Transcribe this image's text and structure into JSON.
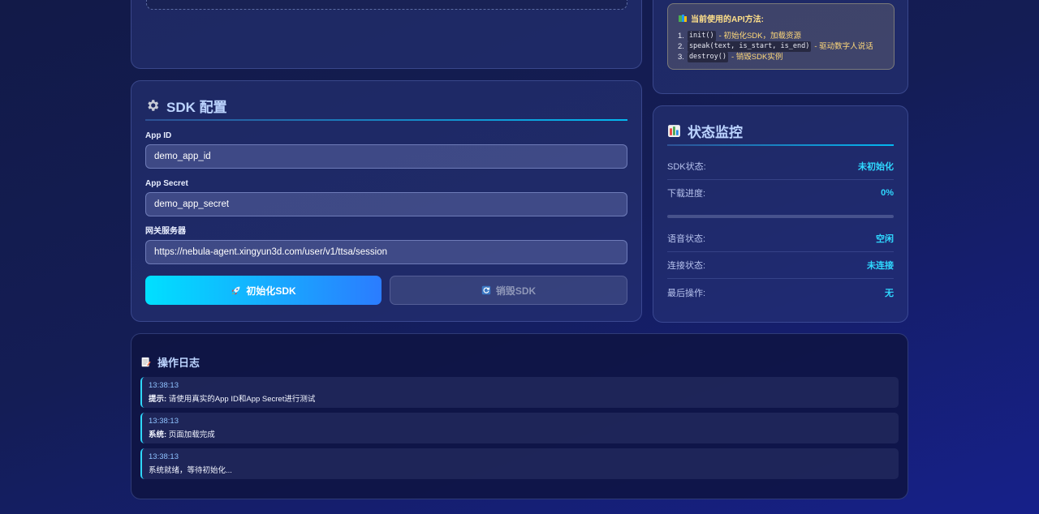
{
  "api_box": {
    "title": "当前使用的API方法:",
    "items": [
      {
        "num": "1.",
        "code": "init()",
        "desc": "- 初始化SDK，加载资源"
      },
      {
        "num": "2.",
        "code": "speak(text, is_start, is_end)",
        "desc": "- 驱动数字人说话"
      },
      {
        "num": "3.",
        "code": "destroy()",
        "desc": "- 销毁SDK实例"
      }
    ]
  },
  "sdk_config": {
    "title": "SDK 配置",
    "app_id_label": "App ID",
    "app_id_value": "demo_app_id",
    "app_secret_label": "App Secret",
    "app_secret_value": "demo_app_secret",
    "gateway_label": "网关服务器",
    "gateway_value": "https://nebula-agent.xingyun3d.com/user/v1/ttsa/session",
    "init_button": "初始化SDK",
    "destroy_button": "销毁SDK"
  },
  "status": {
    "title": "状态监控",
    "sdk_state_label": "SDK状态:",
    "sdk_state_value": "未初始化",
    "progress_label": "下载进度:",
    "progress_value": "0%",
    "progress_fraction": 0,
    "voice_label": "语音状态:",
    "voice_value": "空闲",
    "connection_label": "连接状态:",
    "connection_value": "未连接",
    "last_op_label": "最后操作:",
    "last_op_value": "无"
  },
  "log": {
    "title": "操作日志",
    "entries": [
      {
        "time": "13:38:13",
        "prefix": "提示:",
        "text": " 请使用真实的App ID和App Secret进行测试"
      },
      {
        "time": "13:38:13",
        "prefix": "系统:",
        "text": " 页面加载完成"
      },
      {
        "time": "13:38:13",
        "prefix": "",
        "text": "系统就绪，等待初始化..."
      }
    ]
  },
  "colors": {
    "accent": "#2fd8ff",
    "button_gradient_start": "#00e0ff",
    "button_gradient_end": "#2b7cff",
    "api_text": "#ffd97a"
  },
  "icons": {
    "api": "book-icon",
    "sdk": "gear-icon",
    "status": "bar-chart-icon",
    "log": "memo-icon",
    "init": "rocket-icon",
    "destroy": "refresh-icon"
  }
}
